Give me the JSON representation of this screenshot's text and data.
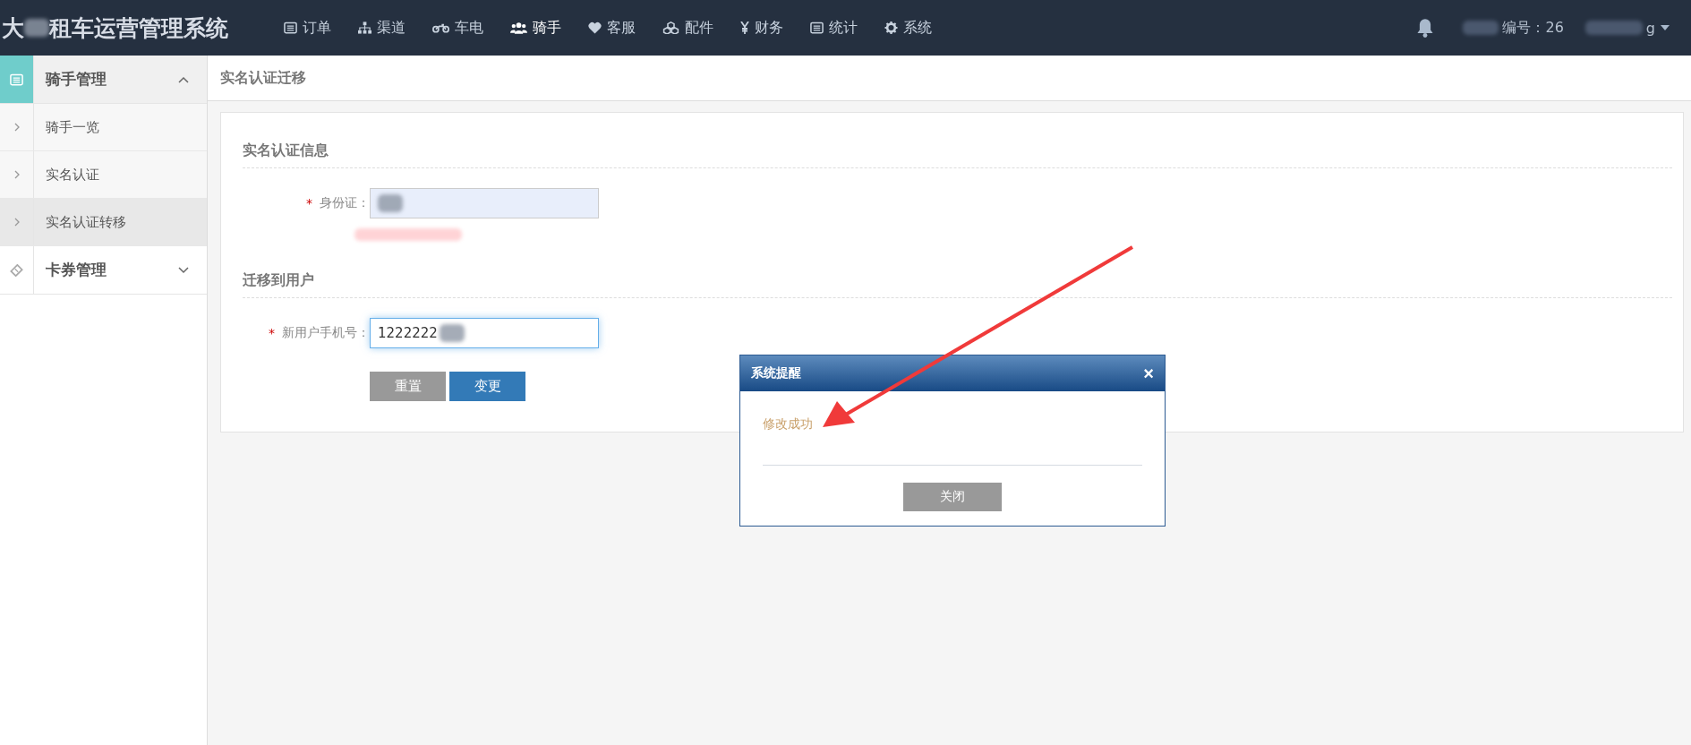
{
  "header": {
    "logo_start": "大",
    "logo_end": "租车运营管理系统",
    "nav": [
      {
        "label": "订单",
        "selected": false
      },
      {
        "label": "渠道",
        "selected": false
      },
      {
        "label": "车电",
        "selected": false
      },
      {
        "label": "骑手",
        "selected": true
      },
      {
        "label": "客服",
        "selected": false
      },
      {
        "label": "配件",
        "selected": false
      },
      {
        "label": "财务",
        "selected": false
      },
      {
        "label": "统计",
        "selected": false
      },
      {
        "label": "系统",
        "selected": false
      }
    ],
    "user_number": "编号：26",
    "user_name_end": "g"
  },
  "sidebar": {
    "groups": [
      {
        "label": "骑手管理",
        "expanded": true,
        "children": [
          {
            "label": "骑手一览",
            "selected": false
          },
          {
            "label": "实名认证",
            "selected": false
          },
          {
            "label": "实名认证转移",
            "selected": true
          }
        ]
      },
      {
        "label": "卡券管理",
        "expanded": false
      }
    ]
  },
  "page_title": "实名认证迁移",
  "sections": [
    {
      "title": "实名认证信息",
      "field": {
        "label": "身份证：",
        "required_mark": "*",
        "focused": false,
        "filled": true
      },
      "error": true
    },
    {
      "title": "迁移到用户",
      "field": {
        "label": "新用户手机号：",
        "required_mark": "*",
        "value": "1222222",
        "focused": true,
        "filled": false
      },
      "error": false
    }
  ],
  "buttons": [
    {
      "label": "重置",
      "kind": "secondary"
    },
    {
      "label": "变更",
      "kind": "primary"
    }
  ],
  "dialog": {
    "title": "系统提醒",
    "close": "×",
    "message": "修改成功",
    "button": "关闭"
  }
}
